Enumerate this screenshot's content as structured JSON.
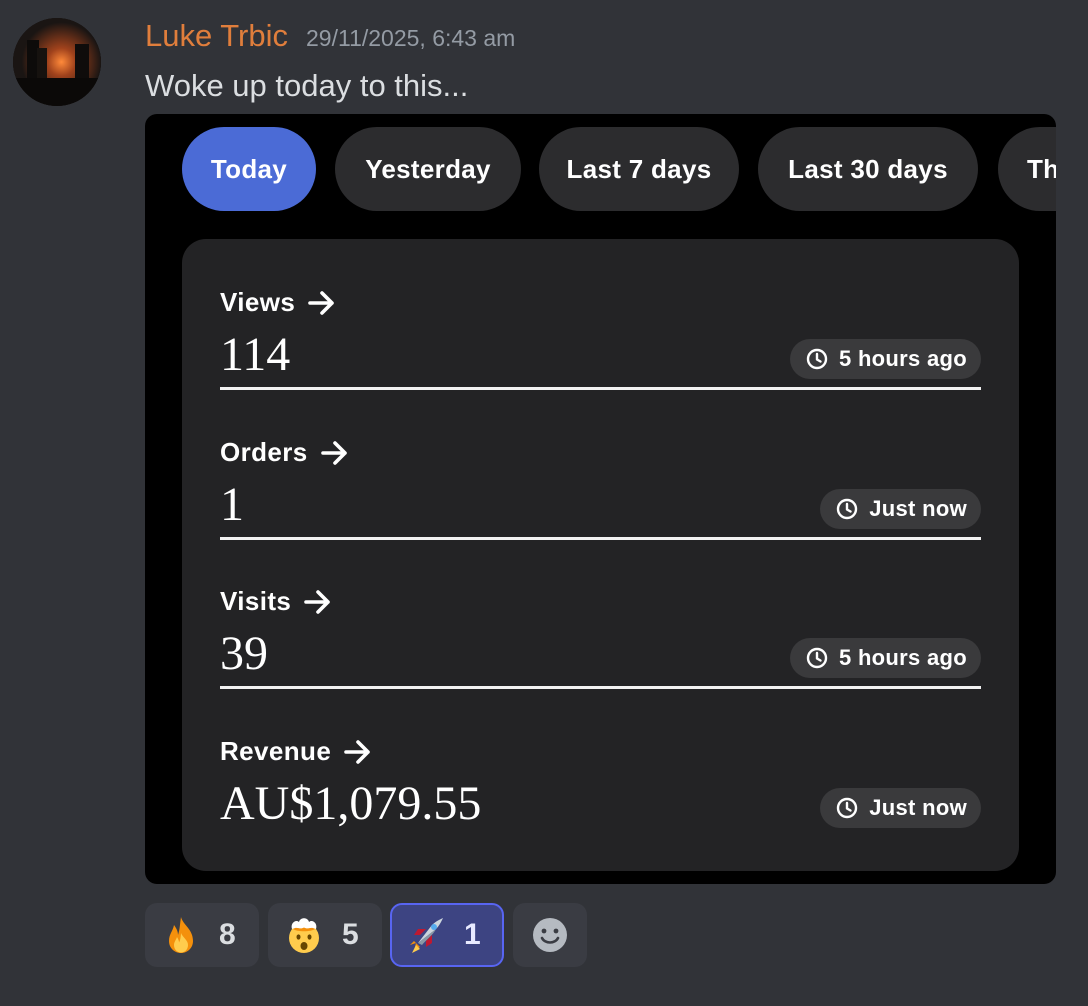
{
  "message": {
    "author": "Luke Trbic",
    "author_color": "#e07e3c",
    "timestamp": "29/11/2025, 6:43 am",
    "text": "Woke up today to this..."
  },
  "attachment": {
    "tabs": [
      {
        "label": "Today",
        "active": true
      },
      {
        "label": "Yesterday",
        "active": false
      },
      {
        "label": "Last 7 days",
        "active": false
      },
      {
        "label": "Last 30 days",
        "active": false
      },
      {
        "label": "Th",
        "active": false
      }
    ],
    "accent_color": "#4b6bd6",
    "stats": [
      {
        "label": "Views",
        "value": "114",
        "updated": "5 hours ago"
      },
      {
        "label": "Orders",
        "value": "1",
        "updated": "Just now"
      },
      {
        "label": "Visits",
        "value": "39",
        "updated": "5 hours ago"
      },
      {
        "label": "Revenue",
        "value": "AU$1,079.55",
        "updated": "Just now"
      }
    ]
  },
  "reactions": [
    {
      "emoji": "fire-emoji",
      "count": "8",
      "active": false
    },
    {
      "emoji": "exploding-head-emoji",
      "count": "5",
      "active": false
    },
    {
      "emoji": "rocket-emoji",
      "count": "1",
      "active": true
    },
    {
      "emoji": "add-reaction-smiley-icon",
      "count": null,
      "active": false
    }
  ]
}
